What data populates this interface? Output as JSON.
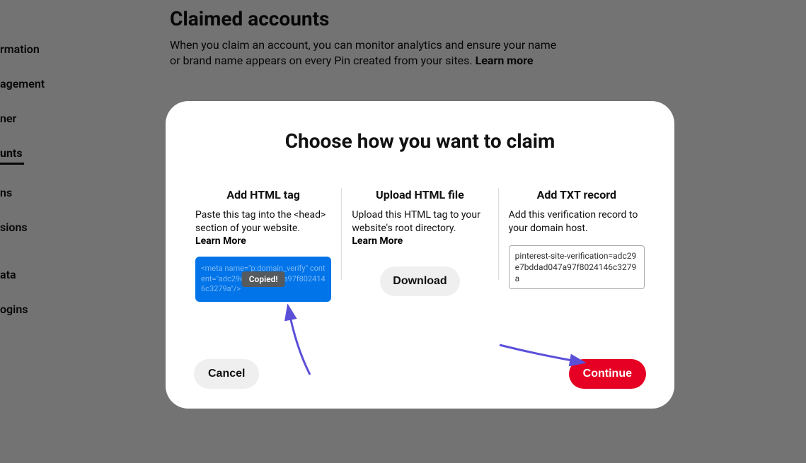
{
  "sidebar": {
    "items": [
      {
        "label": "rmation"
      },
      {
        "label": "agement"
      },
      {
        "label": "ner"
      },
      {
        "label": "unts",
        "active": true
      },
      {
        "label": "ns"
      },
      {
        "label": "sions"
      },
      {
        "label": "ata"
      },
      {
        "label": "ogins"
      }
    ]
  },
  "page": {
    "title": "Claimed accounts",
    "description": "When you claim an account, you can monitor analytics and ensure your name or brand name appears on every Pin created from your sites. ",
    "learn_more": "Learn more"
  },
  "modal": {
    "title": "Choose how you want to claim",
    "col1": {
      "title": "Add HTML tag",
      "desc": "Paste this tag into the <head> section of your website.",
      "learn_more": "Learn More",
      "code": "<meta name=\"p:domain_verify\" content=\"adc29e7bddad047a97f8024146c3279a\"/>",
      "copied": "Copied!"
    },
    "col2": {
      "title": "Upload HTML file",
      "desc": "Upload this HTML tag to your website's root directory.",
      "learn_more": "Learn More",
      "download": "Download"
    },
    "col3": {
      "title": "Add TXT record",
      "desc": "Add this verification record to your domain host.",
      "txt": "pinterest-site-verification=adc29e7bddad047a97f8024146c3279a"
    },
    "cancel": "Cancel",
    "continue": "Continue"
  }
}
